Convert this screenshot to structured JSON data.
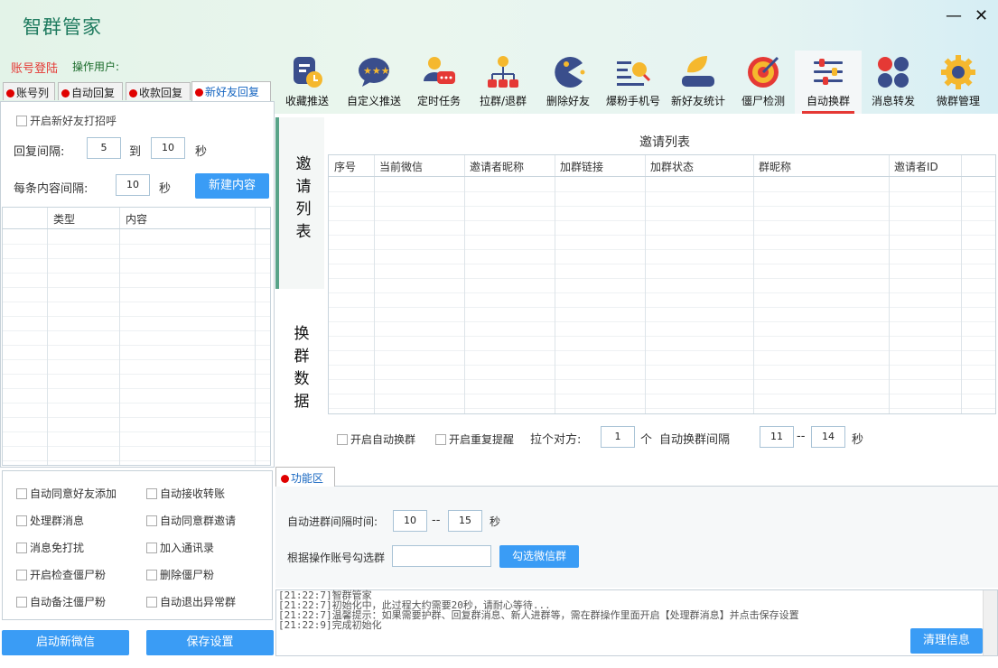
{
  "app": {
    "title": "智群管家",
    "minimize": "—",
    "close": "✕"
  },
  "account": {
    "login_label": "账号登陆",
    "operator_label": "操作用户:"
  },
  "left_tabs": [
    "账号列",
    "自动回复",
    "收款回复",
    "新好友回复"
  ],
  "nav": [
    {
      "label": "收藏推送",
      "icon": "bookmark-clock-icon"
    },
    {
      "label": "自定义推送",
      "icon": "chat-bubble-icon"
    },
    {
      "label": "定时任务",
      "icon": "user-message-icon"
    },
    {
      "label": "拉群/退群",
      "icon": "org-chart-icon"
    },
    {
      "label": "删除好友",
      "icon": "pacman-icon"
    },
    {
      "label": "爆粉手机号",
      "icon": "list-search-icon"
    },
    {
      "label": "新好友统计",
      "icon": "leaf-stats-icon"
    },
    {
      "label": "僵尸检测",
      "icon": "target-icon"
    },
    {
      "label": "自动换群",
      "icon": "sliders-icon"
    },
    {
      "label": "消息转发",
      "icon": "dots-icon"
    },
    {
      "label": "微群管理",
      "icon": "gear-icon"
    }
  ],
  "new_friend": {
    "enable_label": "开启新好友打招呼",
    "reply_interval_label": "回复间隔:",
    "min": "5",
    "to": "到",
    "max": "10",
    "sec": "秒",
    "content_interval_label": "每条内容间隔:",
    "content_interval": "10",
    "sec2": "秒",
    "new_content_button": "新建内容",
    "columns": [
      "类型",
      "内容"
    ]
  },
  "options": [
    [
      "自动同意好友添加",
      "自动接收转账"
    ],
    [
      "处理群消息",
      "自动同意群邀请"
    ],
    [
      "消息免打扰",
      "加入通讯录"
    ],
    [
      "开启检查僵尸粉",
      "删除僵尸粉"
    ],
    [
      "自动备注僵尸粉",
      "自动退出异常群"
    ]
  ],
  "bottom_buttons": {
    "start": "启动新微信",
    "save": "保存设置"
  },
  "side_labels": {
    "top": "邀请列表",
    "bottom": "换群数据"
  },
  "invite": {
    "title": "邀请列表",
    "columns": [
      "序号",
      "当前微信",
      "邀请者昵称",
      "加群链接",
      "加群状态",
      "群昵称",
      "邀请者ID"
    ]
  },
  "auto_switch": {
    "enable_label": "开启自动换群",
    "repeat_label": "开启重复提醒",
    "pull_label": "拉个对方:",
    "pull_value": "1",
    "pull_unit": "个",
    "interval_label": "自动换群间隔",
    "interval_min": "11",
    "dash": "--",
    "interval_max": "14",
    "sec": "秒"
  },
  "function_area": {
    "tab": "功能区",
    "join_interval_label": "自动进群间隔时间:",
    "join_min": "10",
    "dash": "--",
    "join_max": "15",
    "sec": "秒",
    "select_label": "根据操作账号勾选群",
    "select_value": "",
    "select_button": "勾选微信群"
  },
  "log": {
    "lines": [
      "[21:22:7]智群管家",
      "[21:22:7]初始化中，此过程大约需要20秒，请耐心等待...",
      "[21:22:7]温馨提示：如果需要护群、回复群消息、新人进群等，需在群操作里面开启【处理群消息】并点击保存设置",
      "[21:22:9]完成初始化"
    ],
    "clear_button": "清理信息"
  }
}
